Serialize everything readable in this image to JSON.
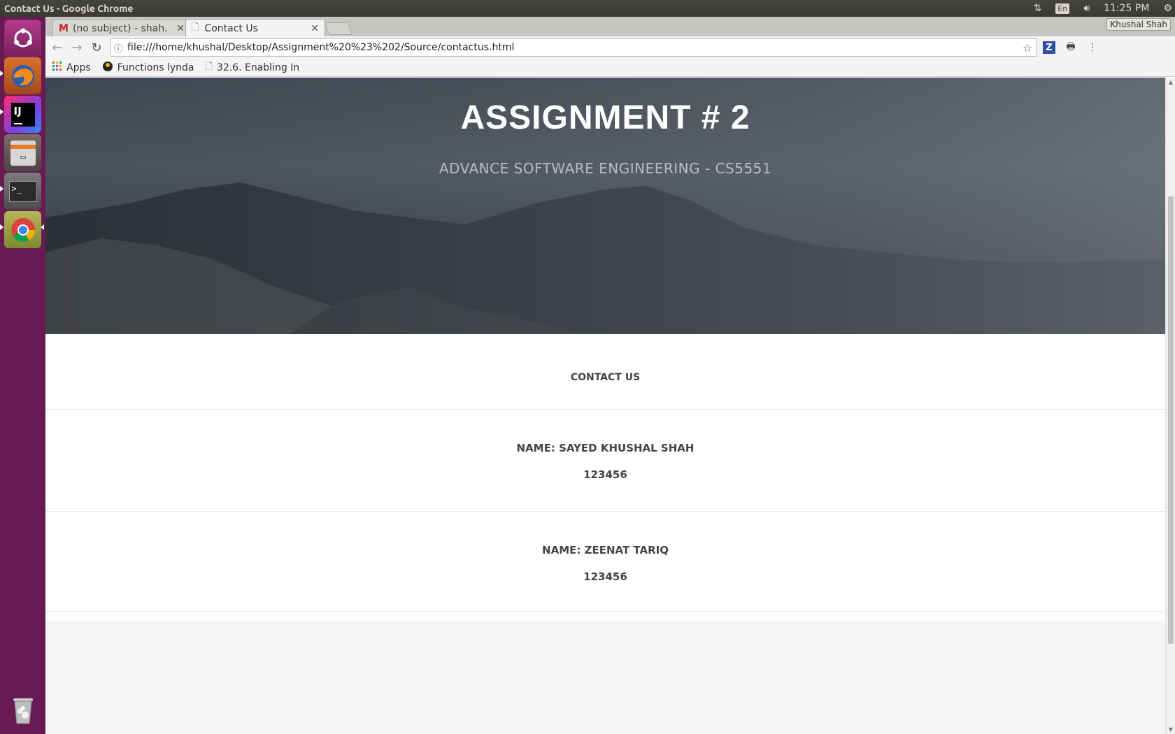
{
  "window": {
    "title": "Contact Us - Google Chrome",
    "clock": "11:25 PM",
    "keyboard_lang": "En",
    "profile_name": "Khushal Shah"
  },
  "tabs": [
    {
      "label": "(no subject) - shah.",
      "icon": "gmail-icon",
      "active": false
    },
    {
      "label": "Contact Us",
      "icon": "page-icon",
      "active": true
    }
  ],
  "toolbar": {
    "url": "file:///home/khushal/Desktop/Assignment%20%23%202/Source/contactus.html"
  },
  "bookmarks": [
    {
      "label": "Apps",
      "icon": "apps-grid-icon"
    },
    {
      "label": "Functions lynda",
      "icon": "lynda-icon"
    },
    {
      "label": "32.6. Enabling In",
      "icon": "page-icon"
    }
  ],
  "launcher": [
    {
      "name": "ubuntu-dash-icon"
    },
    {
      "name": "firefox-icon"
    },
    {
      "name": "intellij-icon"
    },
    {
      "name": "files-icon"
    },
    {
      "name": "terminal-icon"
    },
    {
      "name": "chrome-icon"
    },
    {
      "name": "trash-icon"
    }
  ],
  "hero": {
    "title": "ASSIGNMENT # 2",
    "subtitle": "ADVANCE SOFTWARE ENGINEERING - CS5551"
  },
  "contact": {
    "heading": "CONTACT US",
    "people": [
      {
        "name": "NAME: SAYED KHUSHAL SHAH",
        "number": "123456"
      },
      {
        "name": "NAME: ZEENAT TARIQ",
        "number": "123456"
      }
    ]
  }
}
